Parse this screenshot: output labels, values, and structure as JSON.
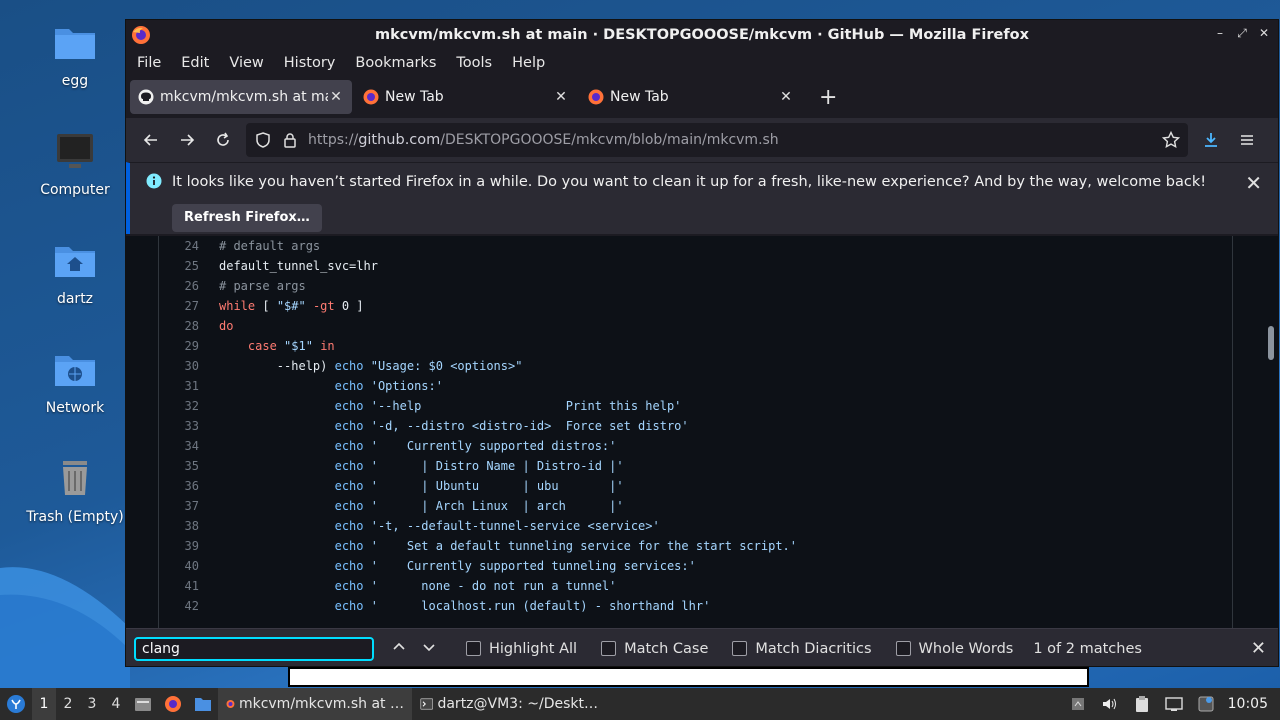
{
  "desktop": {
    "icons": [
      {
        "label": "egg",
        "icon": "folder-icon"
      },
      {
        "label": "Computer",
        "icon": "computer-icon"
      },
      {
        "label": "dartz",
        "icon": "home-folder-icon"
      },
      {
        "label": "Network",
        "icon": "network-folder-icon"
      },
      {
        "label": "Trash (Empty)",
        "icon": "trash-icon"
      }
    ]
  },
  "window": {
    "title": "mkcvm/mkcvm.sh at main · DESKTOPGOOOSE/mkcvm · GitHub — Mozilla Firefox",
    "controls": [
      "minimize",
      "maximize",
      "close"
    ]
  },
  "menu": [
    "File",
    "Edit",
    "View",
    "History",
    "Bookmarks",
    "Tools",
    "Help"
  ],
  "tabs": [
    {
      "title": "mkcvm/mkcvm.sh at main · DESKTOPGOOOSE/mkcvm",
      "icon": "github-icon",
      "active": true
    },
    {
      "title": "New Tab",
      "icon": "firefox-icon",
      "active": false
    },
    {
      "title": "New Tab",
      "icon": "firefox-icon",
      "active": false
    }
  ],
  "address_bar": {
    "scheme": "https://",
    "host": "github.com",
    "path": "/DESKTOPGOOOSE/mkcvm/blob/main/mkcvm.sh"
  },
  "notification": {
    "text": "It looks like you haven’t started Firefox in a while. Do you want to clean it up for a fresh, like-new experience? And by the way, welcome back!",
    "button": "Refresh Firefox…"
  },
  "code": {
    "lines": [
      {
        "n": "24",
        "text": "# default args"
      },
      {
        "n": "25",
        "text": "default_tunnel_svc=lhr"
      },
      {
        "n": "26",
        "text": "# parse args"
      },
      {
        "n": "27",
        "text": "while [ \"$#\" -gt 0 ]"
      },
      {
        "n": "28",
        "text": "do"
      },
      {
        "n": "29",
        "text": "    case \"$1\" in"
      },
      {
        "n": "30",
        "text": "        --help) echo \"Usage: $0 <options>\""
      },
      {
        "n": "31",
        "text": "                echo 'Options:'"
      },
      {
        "n": "32",
        "text": "                echo '--help                    Print this help'"
      },
      {
        "n": "33",
        "text": "                echo '-d, --distro <distro-id>  Force set distro'"
      },
      {
        "n": "34",
        "text": "                echo '    Currently supported distros:'"
      },
      {
        "n": "35",
        "text": "                echo '      | Distro Name | Distro-id |'"
      },
      {
        "n": "36",
        "text": "                echo '      | Ubuntu      | ubu       |'"
      },
      {
        "n": "37",
        "text": "                echo '      | Arch Linux  | arch      |'"
      },
      {
        "n": "38",
        "text": "                echo '-t, --default-tunnel-service <service>'"
      },
      {
        "n": "39",
        "text": "                echo '    Set a default tunneling service for the start script.'"
      },
      {
        "n": "40",
        "text": "                echo '    Currently supported tunneling services:'"
      },
      {
        "n": "41",
        "text": "                echo '      none - do not run a tunnel'"
      },
      {
        "n": "42",
        "text": "                echo '      localhost.run (default) - shorthand lhr'"
      }
    ]
  },
  "find_bar": {
    "query": "clang",
    "options": [
      "Highlight All",
      "Match Case",
      "Match Diacritics",
      "Whole Words"
    ],
    "result": "1 of 2 matches"
  },
  "taskbar": {
    "workspaces": [
      "1",
      "2",
      "3",
      "4"
    ],
    "tasks": [
      {
        "label": "mkcvm/mkcvm.sh at …",
        "icon": "firefox-icon"
      },
      {
        "label": "dartz@VM3: ~/Deskt…",
        "icon": "terminal-icon"
      }
    ],
    "clock": "10:05"
  }
}
